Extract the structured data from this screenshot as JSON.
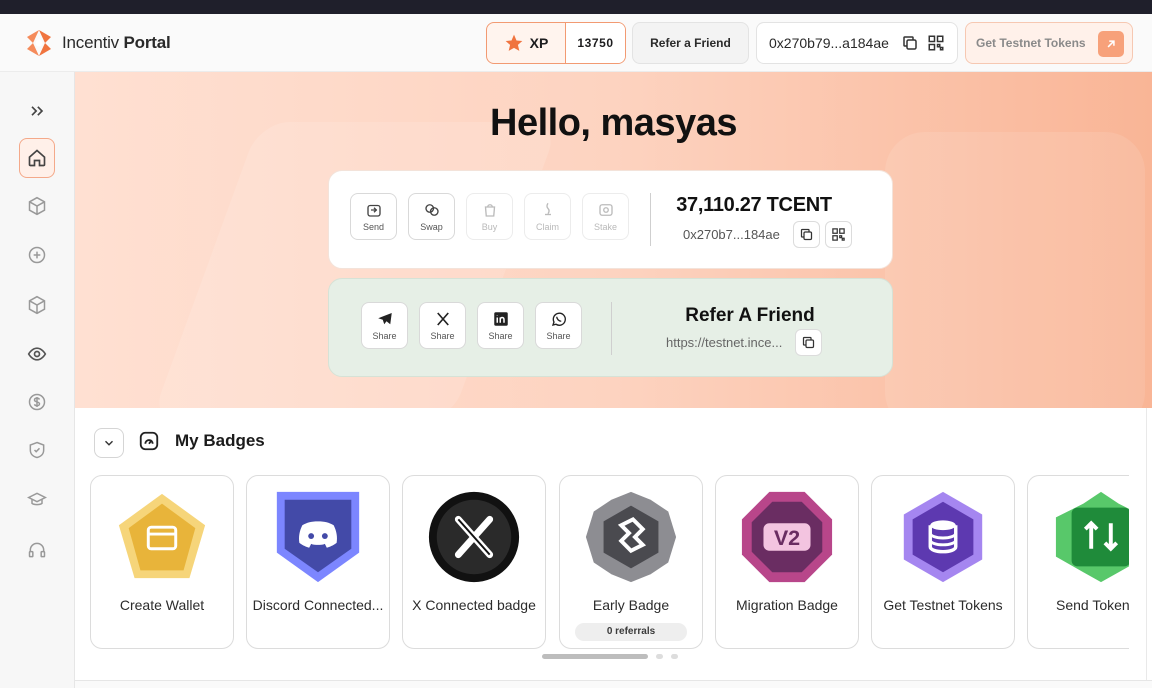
{
  "header": {
    "logo_word1": "Incentiv",
    "logo_word2": "Portal",
    "xp_label": "XP",
    "xp_value": "13750",
    "refer_label": "Refer a Friend",
    "wallet_short": "0x270b79...a184ae",
    "testnet_label": "Get Testnet Tokens"
  },
  "sidebar": {
    "items": [
      {
        "name": "expand",
        "icon": "double-chevron-right-icon"
      },
      {
        "name": "home",
        "icon": "home-icon",
        "active": true
      },
      {
        "name": "cube",
        "icon": "cube-icon"
      },
      {
        "name": "add",
        "icon": "plus-circle-icon"
      },
      {
        "name": "box",
        "icon": "box-icon"
      },
      {
        "name": "explore",
        "icon": "eye-icon"
      },
      {
        "name": "earn",
        "icon": "dollar-icon"
      },
      {
        "name": "security",
        "icon": "shield-icon"
      },
      {
        "name": "learn",
        "icon": "graduation-cap-icon"
      },
      {
        "name": "support",
        "icon": "headset-icon"
      }
    ]
  },
  "hero": {
    "greeting": "Hello, masyas"
  },
  "wallet": {
    "actions": [
      {
        "label": "Send",
        "enabled": true
      },
      {
        "label": "Swap",
        "enabled": true
      },
      {
        "label": "Buy",
        "enabled": false
      },
      {
        "label": "Claim",
        "enabled": false
      },
      {
        "label": "Stake",
        "enabled": false
      }
    ],
    "balance": "37,110.27 TCENT",
    "address": "0x270b7...184ae"
  },
  "refer": {
    "share_buttons": [
      {
        "label": "Share",
        "icon": "telegram-icon"
      },
      {
        "label": "Share",
        "icon": "x-icon"
      },
      {
        "label": "Share",
        "icon": "linkedin-icon"
      },
      {
        "label": "Share",
        "icon": "whatsapp-icon"
      }
    ],
    "title": "Refer A Friend",
    "link": "https://testnet.ince..."
  },
  "badges": {
    "title": "My Badges",
    "items": [
      {
        "name": "Create Wallet",
        "color": "#e8b43a"
      },
      {
        "name": "Discord Connected...",
        "color": "#5865f2"
      },
      {
        "name": "X Connected badge",
        "color": "#1a1a1a"
      },
      {
        "name": "Early Badge",
        "color": "#6d6d72",
        "pill": "0 referrals"
      },
      {
        "name": "Migration Badge",
        "color": "#8b3a78"
      },
      {
        "name": "Get Testnet Tokens",
        "color": "#7b4fd1"
      },
      {
        "name": "Send Token",
        "color": "#2fa84a"
      }
    ]
  },
  "colors": {
    "accent": "#f0743f",
    "hero_start": "#ffe0d2",
    "hero_end": "#f9b596",
    "refer_bg": "#e6efe6"
  }
}
